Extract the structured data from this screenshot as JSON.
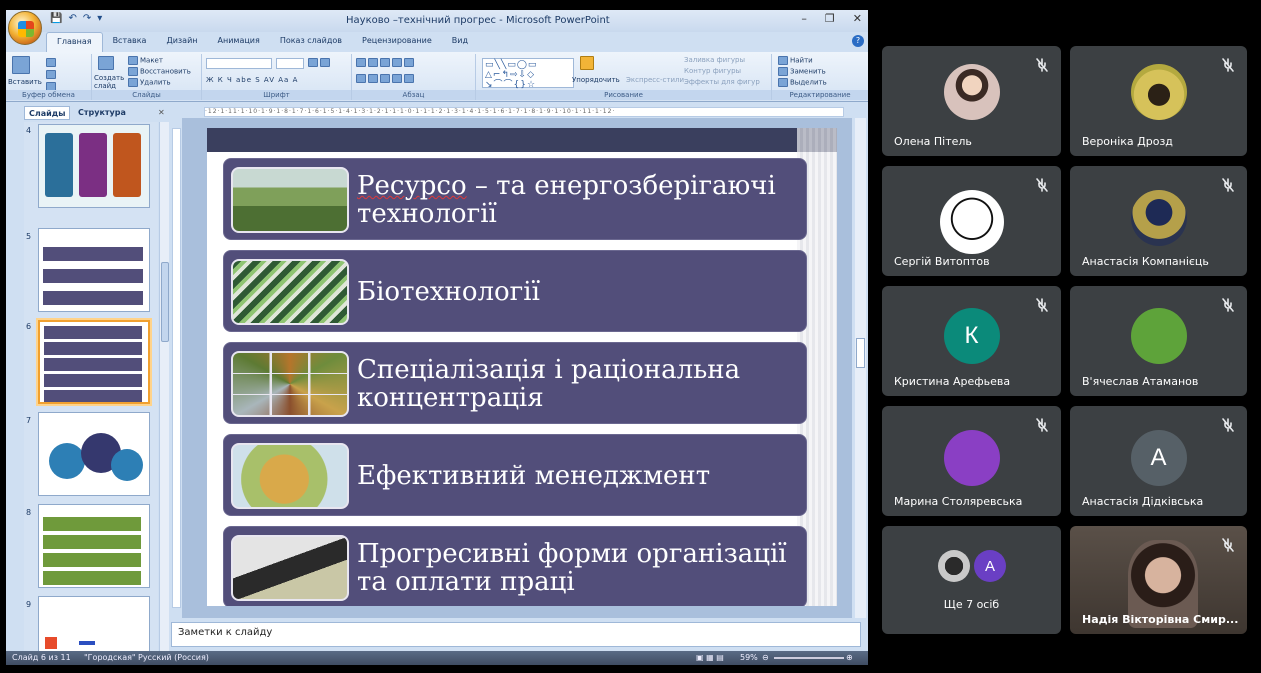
{
  "window": {
    "title": "Науково –технічний прогрес  - Microsoft PowerPoint",
    "controls": [
      "–",
      "❐",
      "✕"
    ],
    "qat": [
      "💾",
      "↶",
      "↷",
      "▾"
    ]
  },
  "ribbon": {
    "tabs": [
      "Главная",
      "Вставка",
      "Дизайн",
      "Анимация",
      "Показ слайдов",
      "Рецензирование",
      "Вид"
    ],
    "active_tab": "Главная",
    "groups": {
      "clipboard": {
        "label": "Буфер обмена",
        "paste": "Вставить"
      },
      "slides": {
        "label": "Слайды",
        "new_slide": "Создать слайд",
        "layout": "Макет",
        "reset": "Восстановить",
        "delete": "Удалить"
      },
      "font": {
        "label": "Шрифт",
        "buttons": "Ж  К  Ч  abe  S  AV  Aa  A"
      },
      "paragraph": {
        "label": "Абзац"
      },
      "drawing": {
        "label": "Рисование",
        "arrange": "Упорядочить",
        "quick_styles": "Экспресс-стили",
        "fill": "Заливка фигуры",
        "outline": "Контур фигуры",
        "effects": "Эффекты для фигур"
      },
      "editing": {
        "label": "Редактирование",
        "find": "Найти",
        "replace": "Заменить",
        "select": "Выделить"
      }
    }
  },
  "pane": {
    "tab_slides": "Слайды",
    "tab_outline": "Структура",
    "thumb_numbers": [
      "4",
      "5",
      "6",
      "7",
      "8",
      "9"
    ]
  },
  "ruler_text": "·12·1·11·1·10·1·9·1·8·1·7·1·6·1·5·1·4·1·3·1·2·1·1·1·0·1·1·1·2·1·3·1·4·1·5·1·6·1·7·1·8·1·9·1·10·1·11·1·12·",
  "slide": {
    "items": [
      {
        "text_wavy": "Ресурсо",
        "text_rest": " – та енергозберігаючі технології"
      },
      {
        "text": "Біотехнології"
      },
      {
        "text": "Спеціалізація і раціональна концентрація"
      },
      {
        "text": "Ефективний менеджмент"
      },
      {
        "text": "Прогресивні форми організації та оплати праці"
      }
    ]
  },
  "notes_placeholder": "Заметки к слайду",
  "status": {
    "slide_of": "Слайд 6 из 11",
    "theme": "\"Городская\"",
    "language": "Русский (Россия)",
    "zoom": "59%"
  },
  "participants": [
    {
      "name": "Олена Пітель",
      "type": "photo",
      "muted": true
    },
    {
      "name": "Вероніка Дрозд",
      "type": "photo",
      "muted": true
    },
    {
      "name": "Сергій Витоптов",
      "type": "photo",
      "muted": true
    },
    {
      "name": "Анастасія Компанієць",
      "type": "photo",
      "muted": true
    },
    {
      "name": "Кристина Арефьева",
      "type": "letter",
      "letter": "К",
      "color": "#0b8a7a",
      "muted": true
    },
    {
      "name": "В'ячеслав Атаманов",
      "type": "solid",
      "color": "#5ea33a",
      "muted": true
    },
    {
      "name": "Марина Столяревська",
      "type": "solid",
      "color": "#8a3fc4",
      "muted": true
    },
    {
      "name": "Анастасія Дідківська",
      "type": "letter",
      "letter": "A",
      "color": "#566067",
      "muted": true
    },
    {
      "name": "Ще 7 осіб",
      "type": "more",
      "letter": "A",
      "color": "#6a3fc4"
    },
    {
      "name": "Надія Вікторівна Смир...",
      "type": "video",
      "muted": true
    }
  ]
}
